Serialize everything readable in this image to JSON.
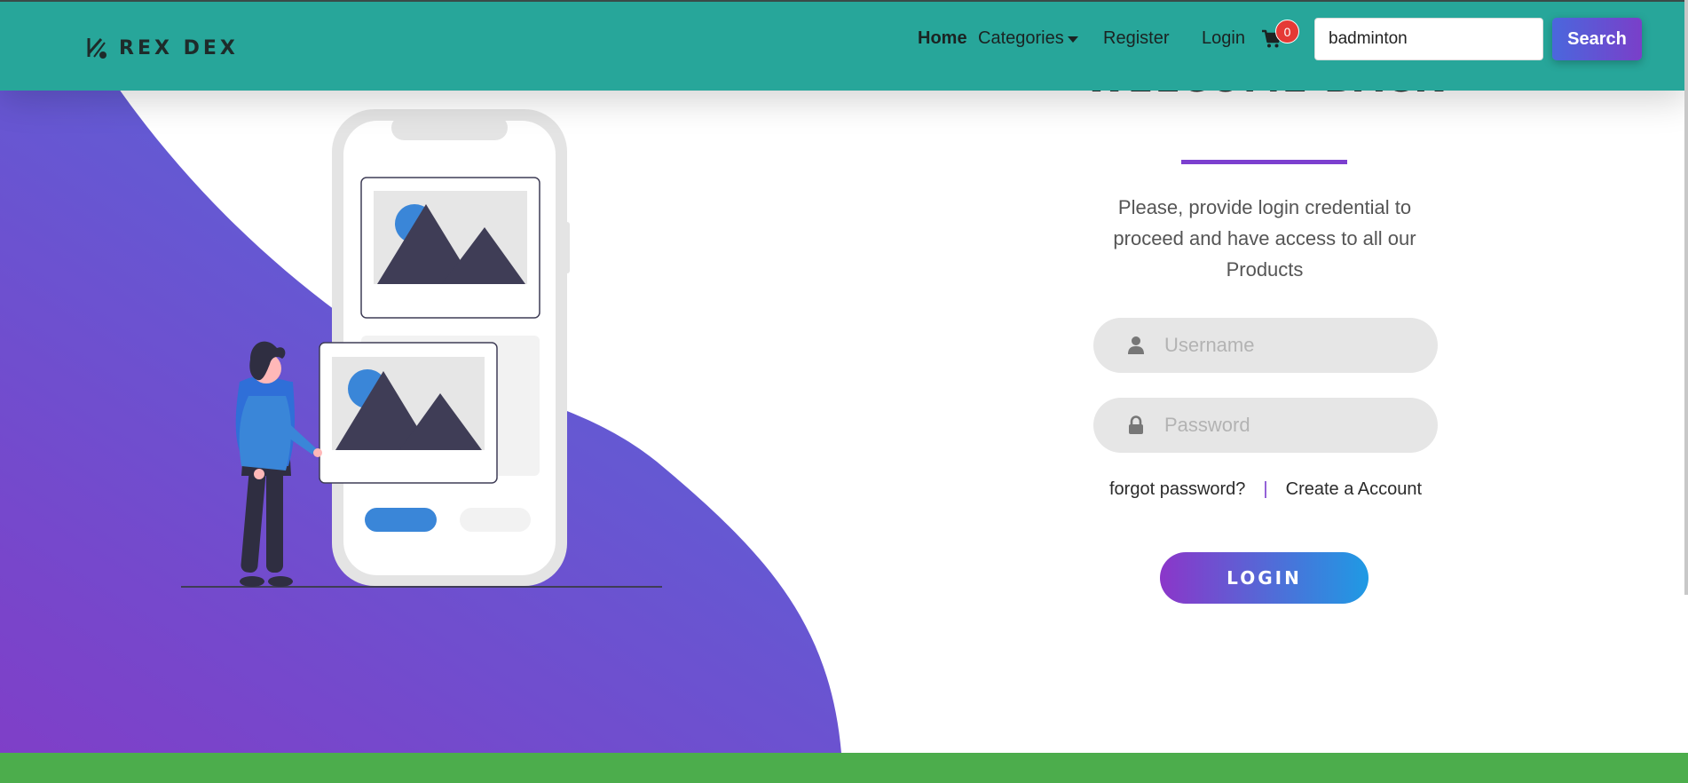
{
  "brand": {
    "name": "REX DEX",
    "logo_icon": "brand-logo-icon"
  },
  "nav": {
    "home": "Home",
    "categories": "Categories",
    "register": "Register",
    "login": "Login",
    "cart_icon": "cart-icon",
    "cart_count": "0"
  },
  "search": {
    "value": "badminton",
    "button_label": "Search"
  },
  "login_form": {
    "title": "WELCOME BACK",
    "subtitle": "Please, provide login credential to proceed and have access to all our Products",
    "username_placeholder": "Username",
    "password_placeholder": "Password",
    "forgot_link": "forgot password?",
    "separator": "|",
    "create_account_link": "Create a Account",
    "submit_label": "LOGIN"
  },
  "colors": {
    "navbar": "#27a69a",
    "accent_purple": "#7c3fcf",
    "blob_top": "#5a63d8",
    "blob_bottom": "#7e3fc9",
    "footer": "#4cad4c"
  }
}
